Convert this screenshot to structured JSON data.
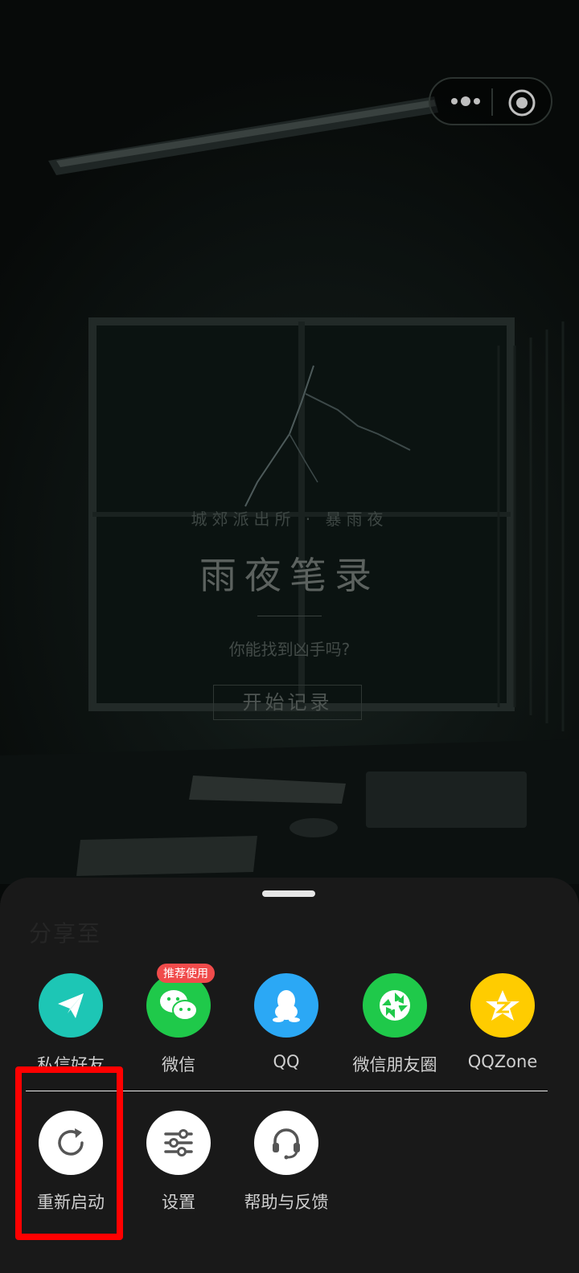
{
  "capsule": {
    "more_icon": "more-dots-icon",
    "close_icon": "target-close-icon"
  },
  "game": {
    "subtitle": "城郊派出所 · 暴雨夜",
    "title": "雨夜笔录",
    "question": "你能找到凶手吗?",
    "start_button": "开始记录"
  },
  "sheet": {
    "title": "分享至",
    "share_items": [
      {
        "label": "私信好友",
        "icon": "paper-plane-icon",
        "color": "#1dc6b5"
      },
      {
        "label": "微信",
        "icon": "wechat-icon",
        "color": "#1fc94a",
        "badge": "推荐使用"
      },
      {
        "label": "QQ",
        "icon": "qq-penguin-icon",
        "color": "#2ba8f5"
      },
      {
        "label": "微信朋友圈",
        "icon": "moments-shutter-icon",
        "color": "#1fc94a"
      },
      {
        "label": "QQZone",
        "icon": "qzone-star-icon",
        "color": "#ffcc00"
      }
    ],
    "action_items": [
      {
        "label": "重新启动",
        "icon": "refresh-icon",
        "color": "#ffffff"
      },
      {
        "label": "设置",
        "icon": "sliders-icon",
        "color": "#ffffff"
      },
      {
        "label": "帮助与反馈",
        "icon": "headset-icon",
        "color": "#ffffff"
      }
    ]
  }
}
